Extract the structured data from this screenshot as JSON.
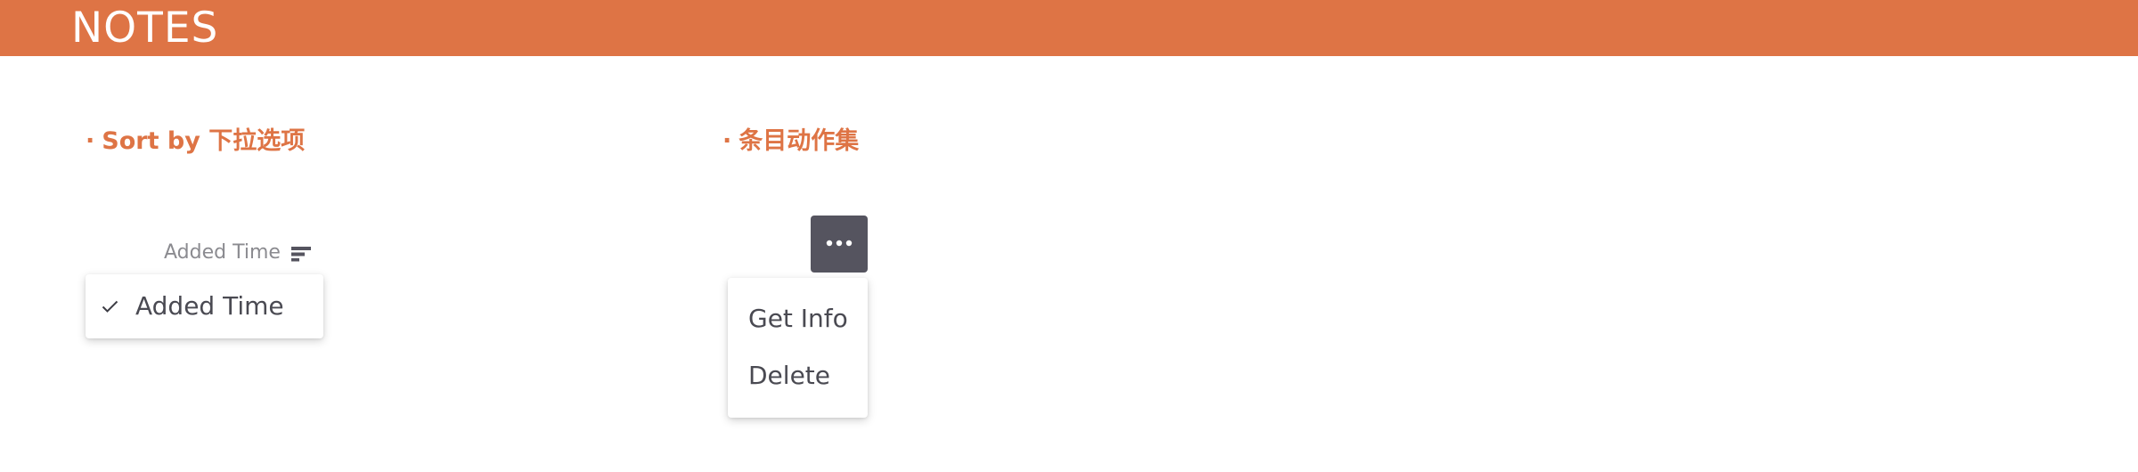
{
  "header": {
    "title": "NOTES"
  },
  "sections": {
    "sort": {
      "bullet": "·",
      "title": "Sort by 下拉选项"
    },
    "actions": {
      "bullet": "·",
      "title": "条目动作集"
    }
  },
  "sort": {
    "current_label": "Added Time",
    "sort_icon": "sort-lines-icon",
    "menu": {
      "items": [
        {
          "label": "Added Time",
          "selected": true,
          "icon": "check-icon"
        }
      ]
    }
  },
  "actions": {
    "button_icon": "more-horizontal-icon",
    "menu": {
      "items": [
        {
          "label": "Get Info"
        },
        {
          "label": "Delete"
        }
      ]
    }
  },
  "colors": {
    "accent": "#DE7445",
    "button_bg": "#55545F",
    "text_muted": "#8b8b90",
    "text_menu": "#4a4a52"
  }
}
